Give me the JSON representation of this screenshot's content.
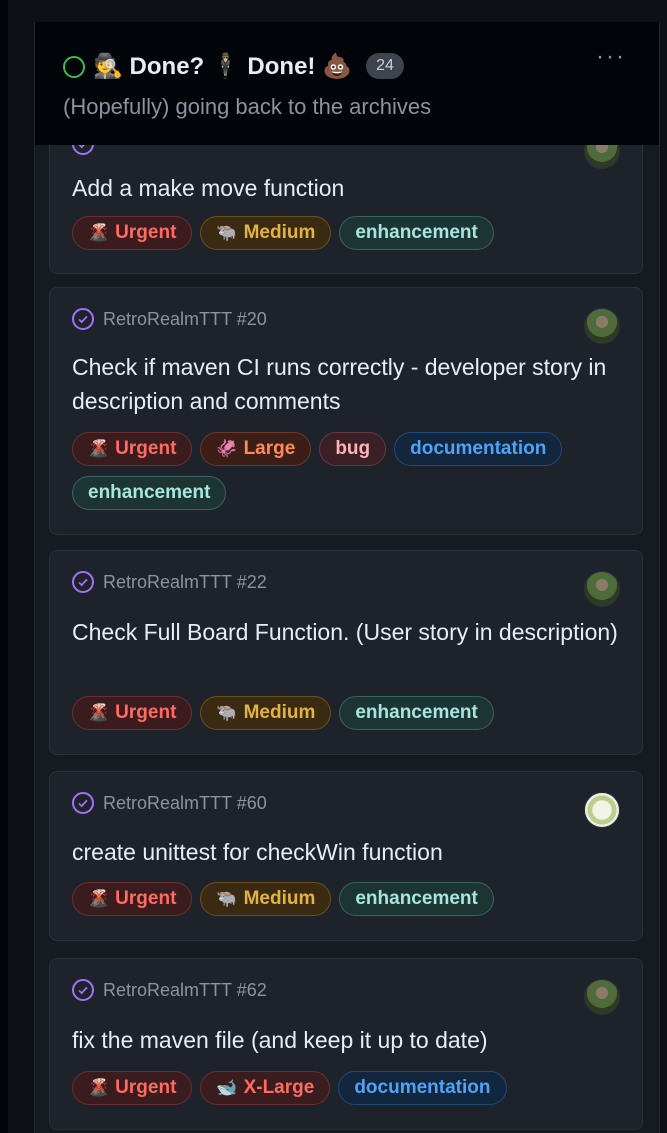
{
  "column": {
    "title": "🕵️ Done? 🕴️ Done! 💩",
    "count": "24",
    "subtitle": "(Hopefully) going back to the archives",
    "menu_glyph": "···",
    "status_color": "#3fb950"
  },
  "cards": [
    {
      "ref": "",
      "title": "Add a make move function",
      "avatar": "user-avatar",
      "labels": [
        {
          "emoji": "🌋",
          "text": "Urgent"
        },
        {
          "emoji": "🐃",
          "text": "Medium"
        },
        {
          "emoji": "",
          "text": "enhancement"
        }
      ]
    },
    {
      "ref": "RetroRealmTTT #20",
      "title": "Check if maven CI runs correctly - developer story in description and comments",
      "avatar": "user-avatar",
      "labels": [
        {
          "emoji": "🌋",
          "text": "Urgent"
        },
        {
          "emoji": "🦑",
          "text": "Large"
        },
        {
          "emoji": "",
          "text": "bug"
        },
        {
          "emoji": "",
          "text": "documentation"
        },
        {
          "emoji": "",
          "text": "enhancement"
        }
      ]
    },
    {
      "ref": "RetroRealmTTT #22",
      "title": "Check Full Board Function. (User story in description)",
      "avatar": "user-avatar",
      "labels": [
        {
          "emoji": "🌋",
          "text": "Urgent"
        },
        {
          "emoji": "🐃",
          "text": "Medium"
        },
        {
          "emoji": "",
          "text": "enhancement"
        }
      ]
    },
    {
      "ref": "RetroRealmTTT #60",
      "title": "create unittest for checkWin function",
      "avatar": "user-avatar",
      "labels": [
        {
          "emoji": "🌋",
          "text": "Urgent"
        },
        {
          "emoji": "🐃",
          "text": "Medium"
        },
        {
          "emoji": "",
          "text": "enhancement"
        }
      ]
    },
    {
      "ref": "RetroRealmTTT #62",
      "title": "fix the maven file (and keep it up to date)",
      "avatar": "user-avatar",
      "labels": [
        {
          "emoji": "🌋",
          "text": "Urgent"
        },
        {
          "emoji": "🐋",
          "text": "X-Large"
        },
        {
          "emoji": "",
          "text": "documentation"
        }
      ]
    }
  ]
}
